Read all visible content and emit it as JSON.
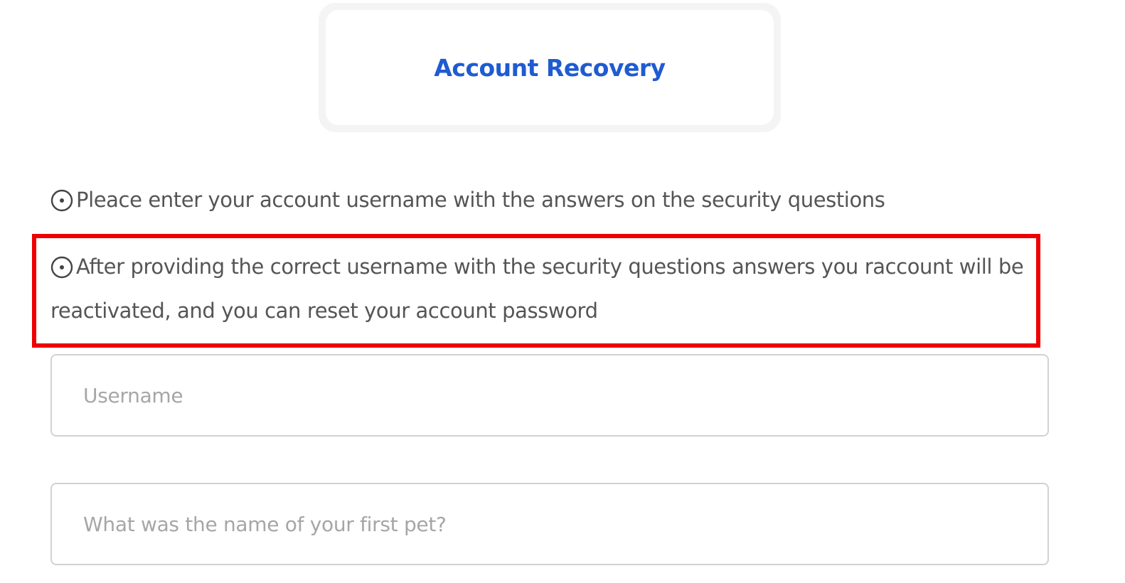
{
  "header": {
    "title": "Account Recovery",
    "title_color": "#1f5bd1"
  },
  "instructions": [
    {
      "icon": "circle-dot-icon",
      "text": "Pleace enter your account username with the answers on the security questions"
    },
    {
      "icon": "circle-dot-icon",
      "text": "After providing the correct username with the security questions answers you raccount will be reactivated, and you can reset your account password"
    }
  ],
  "highlight": {
    "color": "#ee0000"
  },
  "form": {
    "username": {
      "value": "",
      "placeholder": "Username"
    },
    "security_question_1": {
      "value": "",
      "placeholder": "What was the name of your first pet?"
    }
  }
}
